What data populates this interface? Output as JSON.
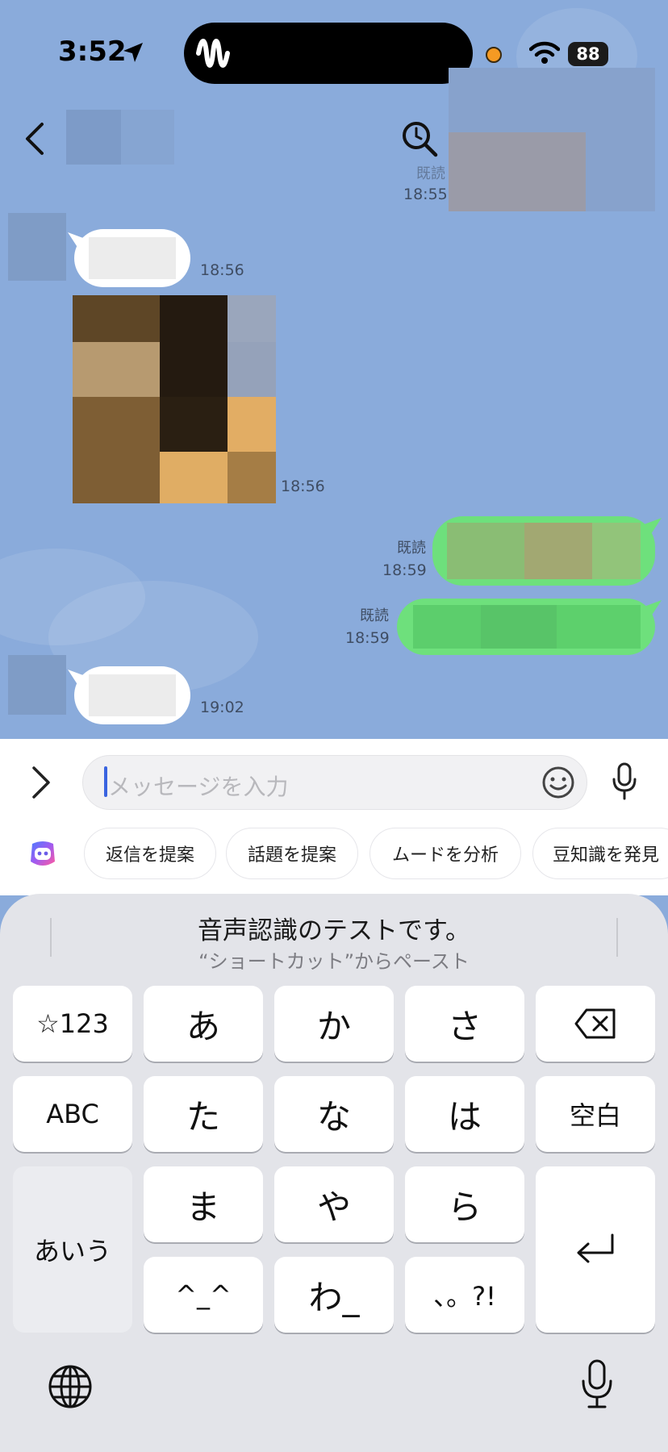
{
  "status_bar": {
    "time": "3:52",
    "battery": "88"
  },
  "messages": {
    "time_top_read": "既読",
    "time_top": "18:55",
    "incoming_1_time": "18:56",
    "image_time": "18:56",
    "outgoing_1_read": "既読",
    "outgoing_1_time": "18:59",
    "outgoing_2_read": "既読",
    "outgoing_2_time": "18:59",
    "incoming_2_time": "19:02"
  },
  "input": {
    "placeholder": "メッセージを入力"
  },
  "chips": [
    "返信を提案",
    "話題を提案",
    "ムードを分析",
    "豆知識を発見"
  ],
  "keyboard": {
    "suggestion": "音声認識のテストです。",
    "suggestion_sub": "“ショートカット”からペースト",
    "keys": {
      "num": "☆123",
      "a": "あ",
      "ka": "か",
      "sa": "さ",
      "abc": "ABC",
      "ta": "た",
      "na": "な",
      "ha": "は",
      "space": "空白",
      "aiu": "あいう",
      "ma": "ま",
      "ya": "や",
      "ra": "ら",
      "emoticon": "^_^",
      "wa": "わ_",
      "punct": "、。?!"
    }
  }
}
